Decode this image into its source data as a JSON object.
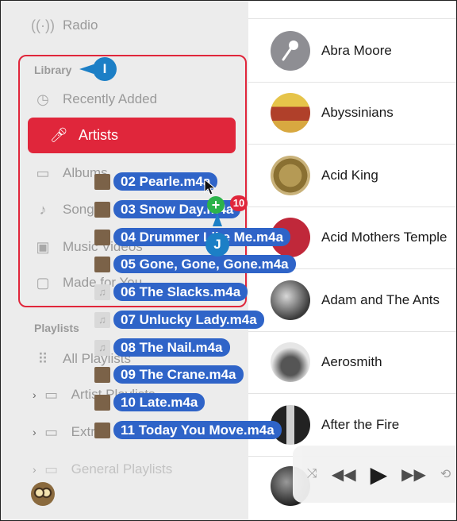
{
  "sidebar": {
    "radio_label": "Radio",
    "library_label": "Library",
    "library_items": [
      {
        "label": "Recently Added",
        "icon": "clock-icon"
      },
      {
        "label": "Artists",
        "icon": "microphone-icon"
      },
      {
        "label": "Albums",
        "icon": "album-icon"
      },
      {
        "label": "Songs",
        "icon": "music-note-icon"
      },
      {
        "label": "Music Videos",
        "icon": "video-icon"
      },
      {
        "label": "Made for You",
        "icon": "person-icon"
      }
    ],
    "playlists_label": "Playlists",
    "playlist_items": [
      {
        "label": "All Playlists"
      },
      {
        "label": "Artist Playlists"
      },
      {
        "label": "Extra"
      },
      {
        "label": "General Playlists"
      }
    ]
  },
  "callouts": {
    "library": "I",
    "drop": "J"
  },
  "drag": {
    "count_badge": "10",
    "plus": "+",
    "items": [
      "02 Pearle.m4a",
      "03 Snow Day.m4a",
      "04 Drummer Like Me.m4a",
      "05 Gone, Gone, Gone.m4a",
      "06 The Slacks.m4a",
      "07 Unlucky Lady.m4a",
      "08 The Nail.m4a",
      "09 The Crane.m4a",
      "10 Late.m4a",
      "11 Today You Move.m4a"
    ]
  },
  "artists": [
    {
      "name": "Abra Moore"
    },
    {
      "name": "Abyssinians"
    },
    {
      "name": "Acid King"
    },
    {
      "name": "Acid Mothers Temple"
    },
    {
      "name": "Adam and The Ants"
    },
    {
      "name": "Aerosmith"
    },
    {
      "name": "After the Fire"
    }
  ],
  "colors": {
    "accent": "#e0263b",
    "callout": "#1c7fc6",
    "drag_pill": "#2f64c8"
  }
}
